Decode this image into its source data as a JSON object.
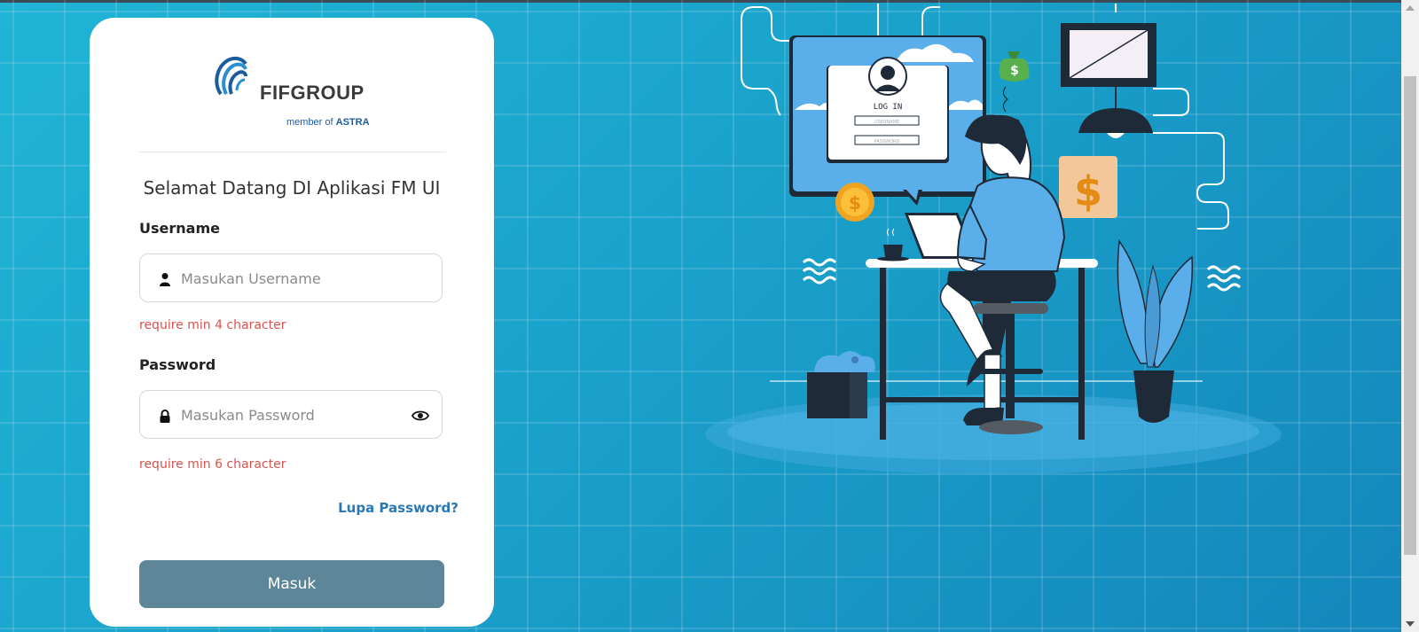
{
  "brand": {
    "name": "FIFGROUP",
    "member_prefix": "member of",
    "member_brand": "ASTRA",
    "primary_color": "#1b5c9f"
  },
  "login": {
    "welcome": "Selamat Datang DI Aplikasi FM UI",
    "username_label": "Username",
    "username_placeholder": "Masukan Username",
    "username_error": "require min 4 character",
    "password_label": "Password",
    "password_placeholder": "Masukan Password",
    "password_error": "require min 6 character",
    "forgot_link": "Lupa Password?",
    "submit_label": "Masuk",
    "button_color": "#5d8799",
    "error_color": "#d9534f"
  },
  "illustration": {
    "screen_title": "LOG IN",
    "screen_field_1": "USERNAME",
    "screen_field_2": "PASSWORD",
    "coin_symbol": "$"
  }
}
